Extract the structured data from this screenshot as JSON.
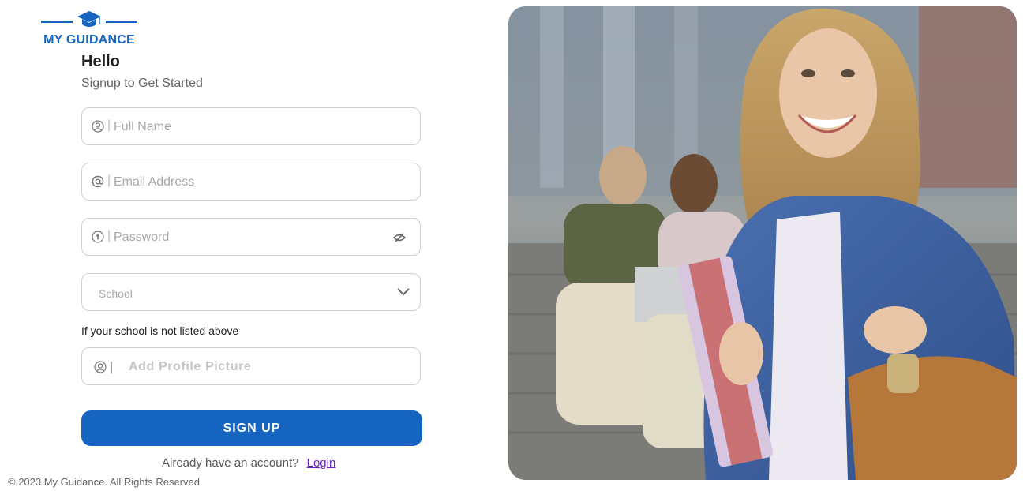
{
  "brand": {
    "name": "MY GUIDANCE",
    "color": "#1565c0",
    "icon": "graduation-cap-icon"
  },
  "heading": {
    "title": "Hello",
    "subtitle": "Signup to Get Started"
  },
  "form": {
    "full_name": {
      "placeholder": "Full Name",
      "icon": "user-circle-icon"
    },
    "email": {
      "placeholder": "Email Address",
      "icon": "at-sign-icon"
    },
    "password": {
      "placeholder": "Password",
      "icon": "lock-circle-icon",
      "toggle_icon": "eye-hidden-icon"
    },
    "school": {
      "selected": "School",
      "icon": "chevron-down-icon"
    },
    "school_note": "If your school is not listed above",
    "profile_picture": {
      "placeholder": "Add Profile Picture",
      "icon": "user-circle-icon"
    },
    "submit_label": "SIGN UP"
  },
  "login_prompt": {
    "text": "Already have an account?",
    "link": "Login"
  },
  "footer": {
    "copyright": "© 2023 My Guidance. All Rights Reserved"
  },
  "colors": {
    "accent": "#1565c0",
    "link": "#6a1fd1"
  }
}
